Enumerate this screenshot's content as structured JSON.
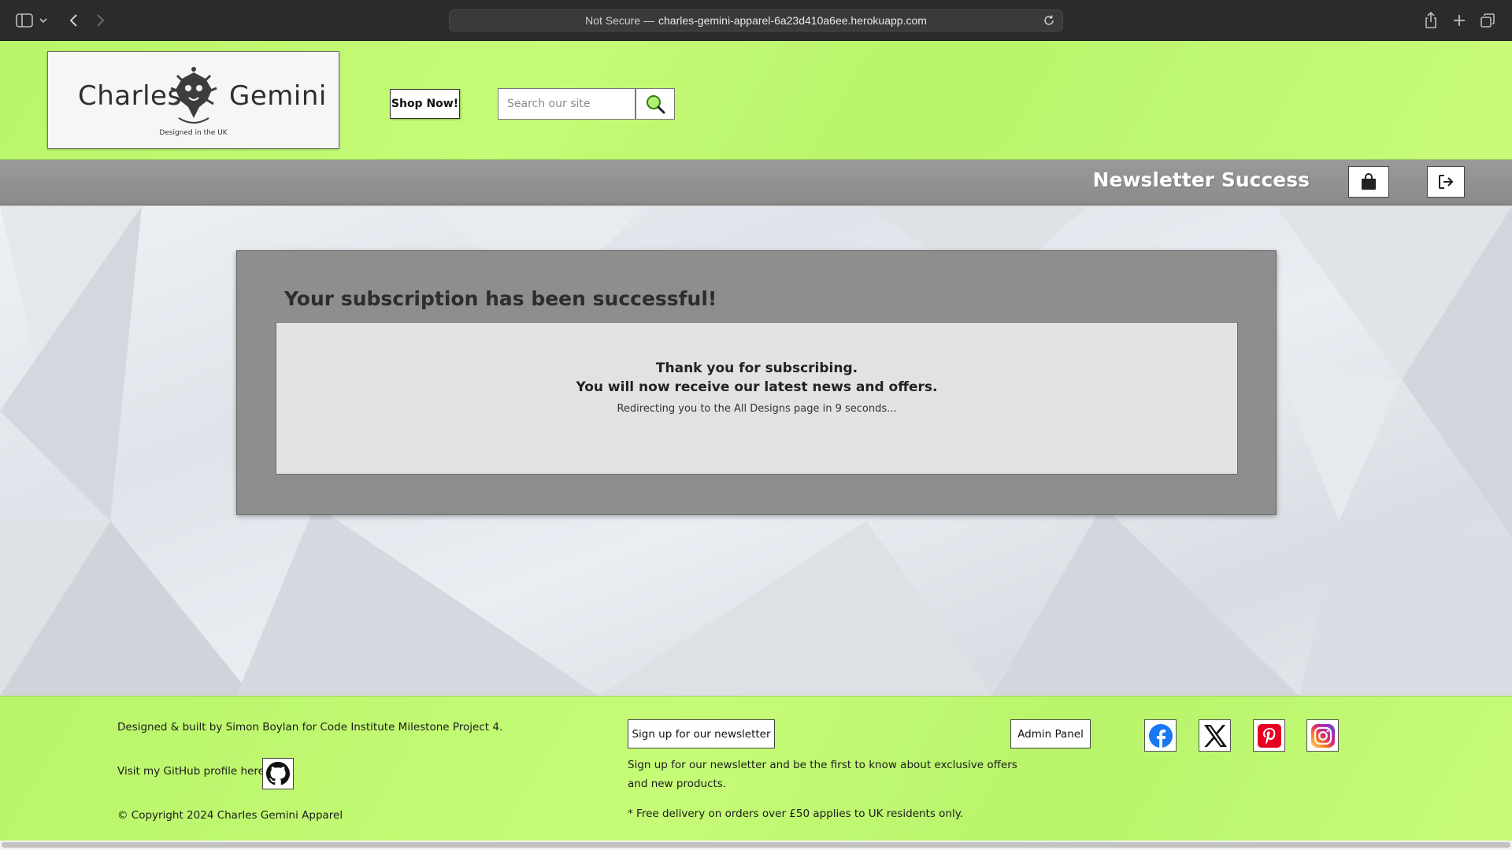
{
  "browser": {
    "security_label": "Not Secure —",
    "url": "charles-gemini-apparel-6a23d410a6ee.herokuapp.com"
  },
  "header": {
    "logo_left": "Charles",
    "logo_right": "Gemini",
    "logo_tagline": "Designed in the UK",
    "shop_label": "Shop Now!",
    "search_placeholder": "Search our site"
  },
  "nav": {
    "page_title": "Newsletter Success"
  },
  "main": {
    "title": "Your subscription has been successful!",
    "line1": "Thank you for subscribing.",
    "line2": "You will now receive our latest news and offers.",
    "redirect_text": "Redirecting you to the All Designs page in 9 seconds..."
  },
  "footer": {
    "credit": "Designed & built by Simon Boylan for Code Institute Milestone Project 4.",
    "github_label": "Visit my GitHub profile here:",
    "copyright": "© Copyright 2024 Charles Gemini Apparel",
    "newsletter_button": "Sign up for our newsletter",
    "newsletter_text": "Sign up for our newsletter and be the first to know about exclusive offers and new products.",
    "delivery_note": "* Free delivery on orders over £50 applies to UK residents only.",
    "admin_button": "Admin Panel"
  },
  "colors": {
    "header_green": "#c2f873",
    "nav_grey": "#929292",
    "card_grey": "#8e8e8e",
    "facebook": "#1877f2",
    "pinterest": "#e60023"
  }
}
